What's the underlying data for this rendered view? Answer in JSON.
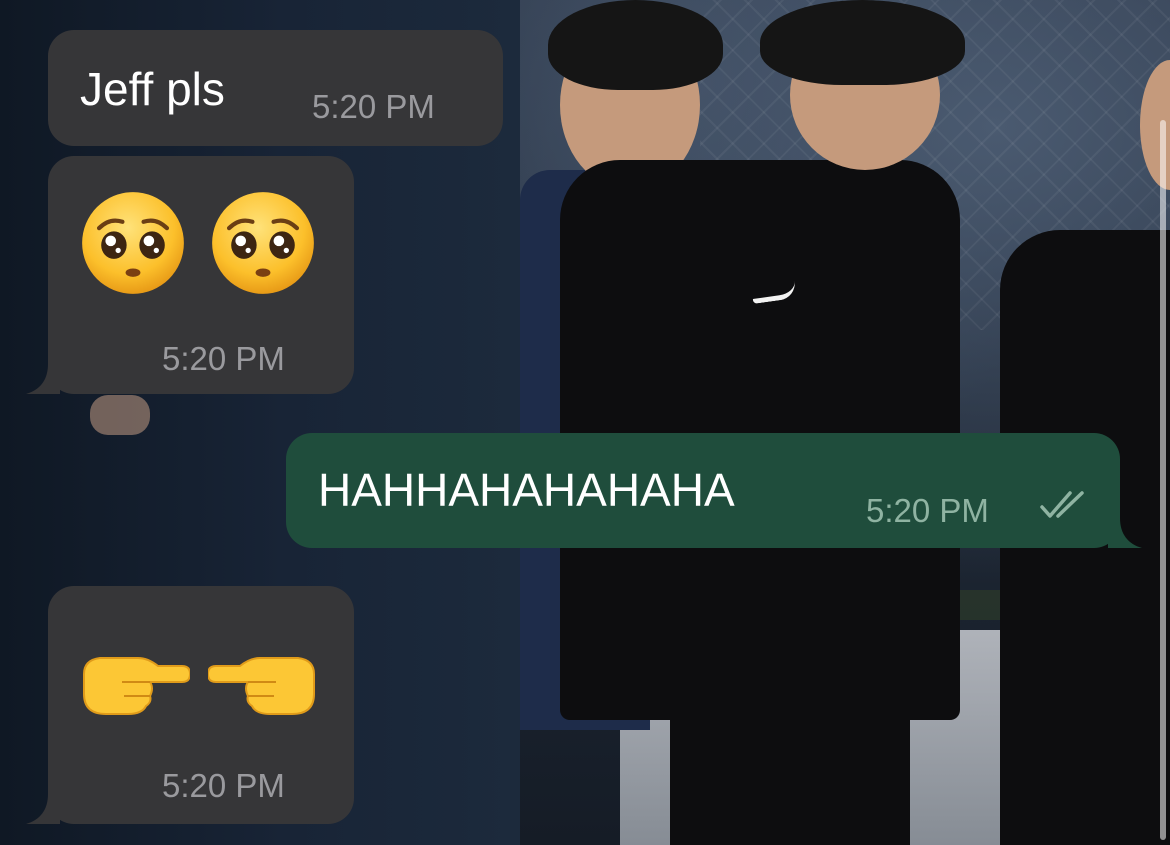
{
  "messages": [
    {
      "id": "m1",
      "direction": "incoming",
      "type": "text",
      "text": "Jeff pls",
      "time": "5:20 PM"
    },
    {
      "id": "m2",
      "direction": "incoming",
      "type": "emoji",
      "emojis": [
        "pleading-face",
        "pleading-face"
      ],
      "time": "5:20 PM"
    },
    {
      "id": "m3",
      "direction": "outgoing",
      "type": "text",
      "text": "HAHHAHAHAHAHA",
      "time": "5:20 PM",
      "status": "read",
      "status_icon": "double-check-icon"
    },
    {
      "id": "m4",
      "direction": "incoming",
      "type": "emoji",
      "emojis": [
        "pointing-right",
        "pointing-left"
      ],
      "time": "5:20 PM"
    }
  ],
  "colors": {
    "incoming_bubble": "#363638",
    "outgoing_bubble": "#1f4d3c",
    "text": "#ffffff",
    "timestamp_incoming": "#9a9a9e",
    "timestamp_outgoing": "#8fb3a2"
  }
}
